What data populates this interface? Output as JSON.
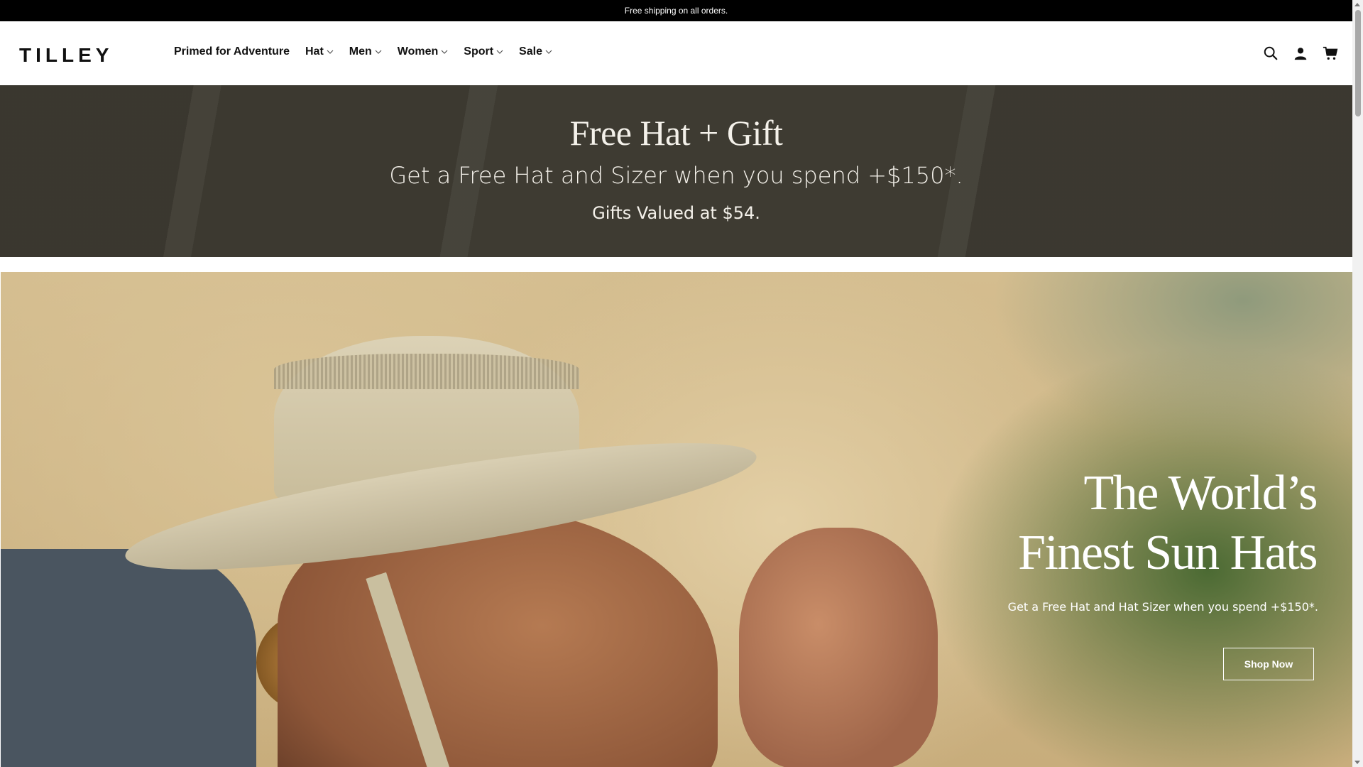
{
  "announcement": "Free shipping on all orders.",
  "header": {
    "logo": "TILLEY",
    "nav": [
      {
        "label": "Primed for Adventure",
        "has_dropdown": false
      },
      {
        "label": "Hat",
        "has_dropdown": true
      },
      {
        "label": "Men",
        "has_dropdown": true
      },
      {
        "label": "Women",
        "has_dropdown": true
      },
      {
        "label": "Sport",
        "has_dropdown": true
      },
      {
        "label": "Sale",
        "has_dropdown": true
      }
    ],
    "icons": [
      "search-icon",
      "account-icon",
      "cart-icon"
    ]
  },
  "promo": {
    "title": "Free Hat + Gift",
    "subtitle": "Get a Free Hat and Sizer when you spend +$150*.",
    "note": "Gifts Valued at $54."
  },
  "hero": {
    "title_line1": "The World’s",
    "title_line2": "Finest Sun Hats",
    "subtitle": "Get a Free Hat and Hat Sizer when you spend +$150*.",
    "button": "Shop Now"
  },
  "colors": {
    "announcement_bg": "#000000",
    "promo_bg": "#3f3c33",
    "hero_text": "#ffffff"
  }
}
